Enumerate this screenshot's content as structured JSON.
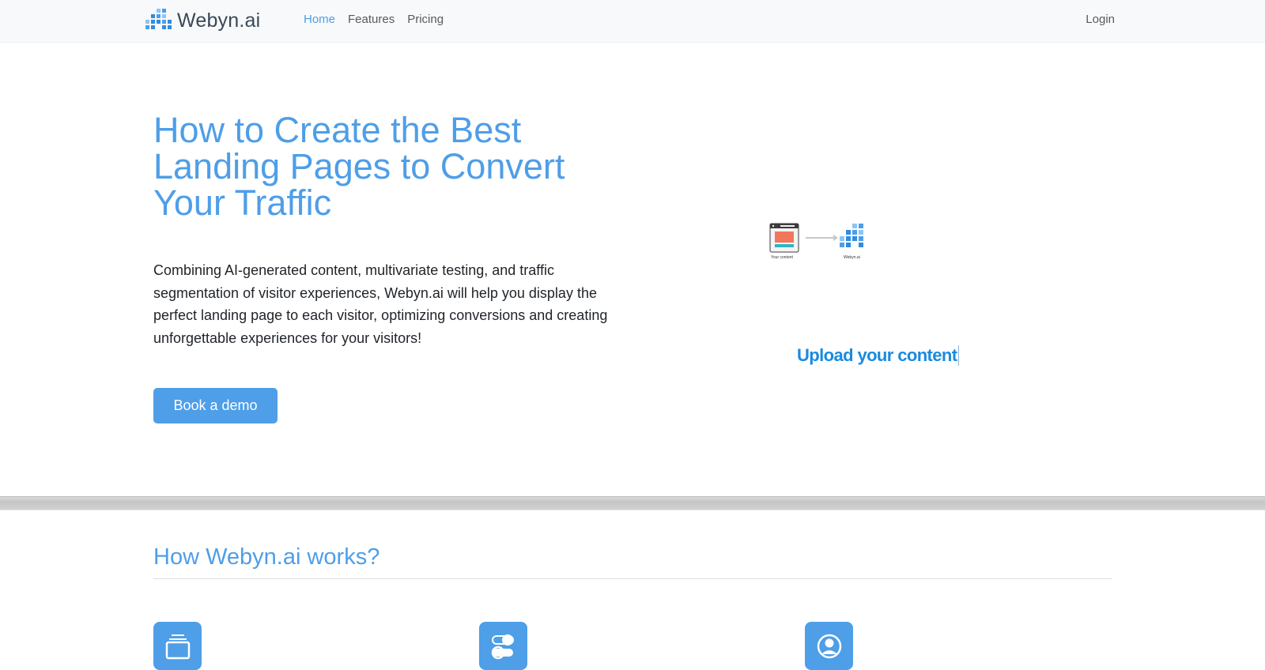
{
  "navbar": {
    "brand": {
      "name": "Webyn",
      "suffix": ".ai"
    },
    "links": [
      {
        "label": "Home",
        "active": true
      },
      {
        "label": "Features",
        "active": false
      },
      {
        "label": "Pricing",
        "active": false
      }
    ],
    "login_label": "Login"
  },
  "hero": {
    "title": "How to Create the Best Landing Pages to Convert Your Traffic",
    "description": "Combining AI-generated content, multivariate testing, and traffic segmentation of visitor experiences, Webyn.ai will help you display the perfect landing page to each visitor, optimizing conversions and creating unforgettable experiences for your visitors!",
    "cta_label": "Book a demo"
  },
  "illustration": {
    "left_caption": "Your content",
    "right_caption": "Webyn.ai",
    "caption": "Upload your content"
  },
  "how_it_works": {
    "title": "How Webyn.ai works?",
    "features": [
      {
        "icon": "browser-window-icon"
      },
      {
        "icon": "toggle-switches-icon"
      },
      {
        "icon": "user-circle-icon"
      }
    ]
  },
  "colors": {
    "accent": "#4e9ee8",
    "navbar_bg": "#f8f9fa",
    "text": "#1f2328",
    "upload_caption": "#1a8ae0"
  }
}
